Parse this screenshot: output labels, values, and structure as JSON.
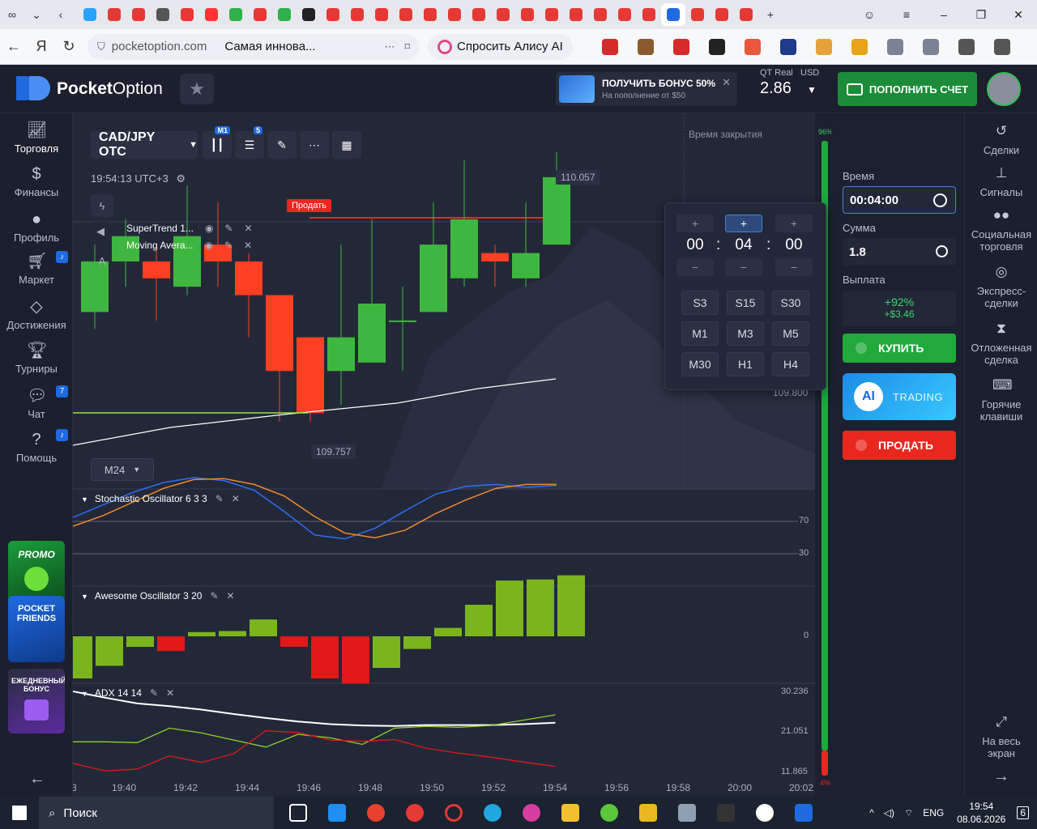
{
  "browser": {
    "tab_favicons": [
      "#2aa3ff",
      "#e53935",
      "#e53935",
      "#555",
      "#e53935",
      "#ff3333",
      "#30b04a",
      "#e53935",
      "#30b04a",
      "#222",
      "#e53935",
      "#e53935",
      "#e53935",
      "#e53935",
      "#e53935",
      "#e53935",
      "#e53935",
      "#e53935",
      "#e53935",
      "#e53935",
      "#e53935",
      "#e53935",
      "#e53935",
      "#e53935",
      "#1f6ae0",
      "#e53935",
      "#e53935",
      "#e53935"
    ],
    "url_domain": "pocketoption.com",
    "page_title": "Самая иннова...",
    "alisa_label": "Спросить Алису AI",
    "extension_icons": [
      "#d62b2b",
      "#8a5a2e",
      "#d62b2b",
      "#222",
      "#e8583a",
      "#1f3a8a",
      "#e5a23a",
      "#e8a317",
      "#7a8294",
      "#7a8294",
      "#555",
      "#555"
    ]
  },
  "header": {
    "brand_strong": "Pocket",
    "brand_thin": "Option",
    "bonus_title": "ПОЛУЧИТЬ БОНУС 50%",
    "bonus_sub": "На пополнение от $50",
    "account_type": "QT Real",
    "account_currency": "USD",
    "balance": "2.86",
    "deposit_label": "ПОПОЛНИТЬ СЧЕТ"
  },
  "leftnav": {
    "items": [
      {
        "label": "Торговля",
        "badge": ""
      },
      {
        "label": "Финансы",
        "badge": ""
      },
      {
        "label": "Профиль",
        "badge": ""
      },
      {
        "label": "Маркет",
        "badge": "🔔"
      },
      {
        "label": "Достижения",
        "badge": ""
      },
      {
        "label": "Турниры",
        "badge": ""
      },
      {
        "label": "Чат",
        "badge": "7"
      },
      {
        "label": "Помощь",
        "badge": "🔔"
      }
    ],
    "promo1": "PROMO",
    "promo2": "POCKET FRIENDS",
    "promo3": "ЕЖЕДНЕВНЫЙ БОНУС"
  },
  "chart": {
    "pair": "CAD/JPY OTC",
    "timeframe_badge": "M1",
    "indicators_count": "5",
    "clock": "19:54:13 UTC+3",
    "indicators": [
      "SuperTrend 1...",
      "Moving Avera..."
    ],
    "sell_tag": "Продать",
    "price_high": "110.057",
    "price_right": "109.800",
    "price_low": "109.757",
    "timeframe": "M24",
    "closing_time_label": "Время закрытия",
    "stoch_title": "Stochastic Oscillator",
    "stoch_params": "6 3 3",
    "stoch_levels": [
      "70",
      "30"
    ],
    "ao_title": "Awesome Oscillator",
    "ao_params": "3 20",
    "ao_zero": "0",
    "adx_title": "ADX",
    "adx_params": "14 14",
    "adx_levels": [
      "30.236",
      "21.051",
      "11.865"
    ],
    "x_ticks": [
      "3",
      "19:40",
      "19:42",
      "19:44",
      "19:46",
      "19:48",
      "19:50",
      "19:52",
      "19:54",
      "19:56",
      "19:58",
      "20:00",
      "20:02"
    ],
    "meter_top": "96%",
    "meter_bottom": "4%"
  },
  "chart_data": [
    {
      "type": "candlestick",
      "title": "CAD/JPY OTC",
      "candles": [
        {
          "o": 109.87,
          "c": 109.93,
          "h": 109.95,
          "l": 109.85
        },
        {
          "o": 109.93,
          "c": 109.96,
          "h": 109.98,
          "l": 109.9
        },
        {
          "o": 109.93,
          "c": 109.91,
          "h": 109.95,
          "l": 109.86
        },
        {
          "o": 109.9,
          "c": 109.96,
          "h": 110.02,
          "l": 109.89
        },
        {
          "o": 109.95,
          "c": 109.93,
          "h": 110.0,
          "l": 109.9
        },
        {
          "o": 109.93,
          "c": 109.89,
          "h": 109.94,
          "l": 109.84
        },
        {
          "o": 109.89,
          "c": 109.8,
          "h": 109.89,
          "l": 109.74
        },
        {
          "o": 109.84,
          "c": 109.75,
          "h": 109.84,
          "l": 109.74
        },
        {
          "o": 109.8,
          "c": 109.84,
          "h": 109.95,
          "l": 109.76
        },
        {
          "o": 109.81,
          "c": 109.88,
          "h": 109.98,
          "l": 109.81
        },
        {
          "o": 109.86,
          "c": 109.86,
          "h": 109.9,
          "l": 109.8
        },
        {
          "o": 109.87,
          "c": 109.95,
          "h": 110.0,
          "l": 109.87
        },
        {
          "o": 109.91,
          "c": 109.98,
          "h": 110.05,
          "l": 109.9
        },
        {
          "o": 109.94,
          "c": 109.93,
          "h": 109.95,
          "l": 109.9
        },
        {
          "o": 109.91,
          "c": 109.94,
          "h": 110.0,
          "l": 109.9
        },
        {
          "o": 109.95,
          "c": 110.03,
          "h": 110.06,
          "l": 109.95
        }
      ],
      "ylim": [
        109.66,
        110.1
      ]
    },
    {
      "type": "line",
      "title": "Stochastic Oscillator",
      "series": [
        {
          "values": [
            54,
            67,
            80,
            90,
            95,
            92,
            82,
            60,
            36,
            32,
            43,
            61,
            78,
            86,
            88,
            85,
            87
          ]
        },
        {
          "values": [
            45,
            56,
            70,
            84,
            93,
            94,
            88,
            76,
            55,
            38,
            33,
            41,
            58,
            72,
            84,
            88,
            88
          ]
        }
      ],
      "ylim": [
        0,
        100
      ]
    },
    {
      "type": "bar",
      "title": "Awesome Oscillator",
      "values": [
        -0.04,
        -0.028,
        -0.01,
        -0.014,
        0.004,
        0.005,
        0.016,
        -0.01,
        -0.04,
        -0.045,
        -0.03,
        -0.012,
        0.008,
        0.03,
        0.053,
        0.054,
        0.058
      ],
      "ylim": [
        -0.05,
        0.08
      ]
    },
    {
      "type": "line",
      "title": "ADX",
      "series": [
        {
          "values": [
            30.236,
            28.8,
            27.5,
            26.9,
            26.1,
            25.1,
            24.2,
            23.4,
            22.8,
            22.5,
            22.4,
            22.6,
            22.6,
            22.6,
            22.8,
            23.1
          ]
        },
        {
          "values": [
            18.8,
            18.8,
            18.6,
            21.9,
            20.8,
            19.2,
            17.6,
            20.5,
            19.7,
            18.2,
            21.9,
            22.3,
            22.1,
            22.5,
            23.7,
            24.9
          ]
        },
        {
          "values": [
            13.9,
            12.2,
            12.6,
            15.6,
            14.1,
            16.1,
            21.3,
            20.9,
            19.2,
            18.9,
            19.3,
            17.3,
            16.2,
            15.3,
            14.2,
            13.2
          ]
        }
      ],
      "ylim": [
        11.865,
        30.236
      ]
    }
  ],
  "timepop": {
    "hours": "00",
    "minutes": "04",
    "seconds": "00",
    "plus": "+",
    "minus": "−",
    "options": [
      "S3",
      "S15",
      "S30",
      "M1",
      "M3",
      "M5",
      "M30",
      "H1",
      "H4"
    ]
  },
  "trade": {
    "time_label": "Время",
    "time_value": "00:04:00",
    "amount_label": "Сумма",
    "amount_value": "1.8",
    "payout_label": "Выплата",
    "payout_percent": "+92%",
    "payout_amount": "+$3.46",
    "buy_label": "КУПИТЬ",
    "ai_icon": "AI",
    "ai_label": "TRADING",
    "sell_label": "ПРОДАТЬ"
  },
  "rightnav": {
    "items": [
      "Сделки",
      "Сигналы",
      "Социальная торговля",
      "Экспресс-сделки",
      "Отложенная сделка",
      "Горячие клавиши",
      "На весь экран"
    ]
  },
  "taskbar": {
    "search_label": "Поиск",
    "lang": "ENG",
    "time": "19:54",
    "date": "08.06.2026",
    "notifications": "6"
  }
}
